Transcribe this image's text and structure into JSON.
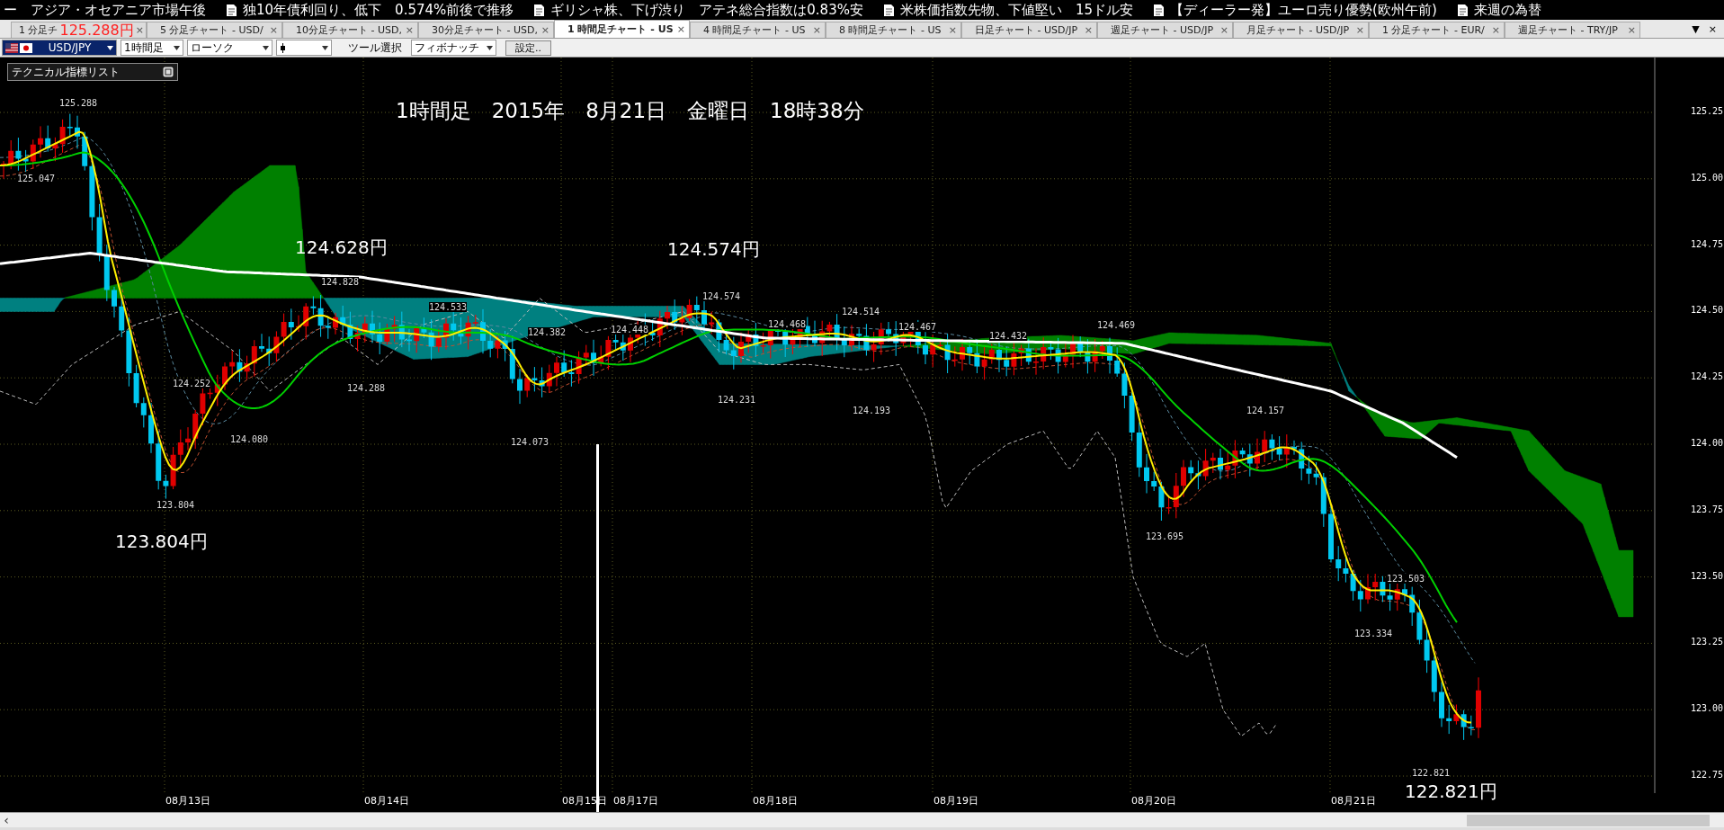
{
  "ticker": {
    "lead": "ー　アジア・オセアニア市場午後",
    "items": [
      "独10年債利回り、低下　0.574%前後で推移",
      "ギリシャ株、下げ渋り　アテネ総合指数は0.83%安",
      "米株価指数先物、下値堅い　15ドル安",
      "【ディーラー発】ユーロ売り優勢(欧州午前)",
      "来週の為替"
    ]
  },
  "tabs": [
    {
      "label": "1 分足チ",
      "selected": false
    },
    {
      "label": "5 分足チャート - USD/",
      "selected": false
    },
    {
      "label": "10分足チャート - USD,",
      "selected": false
    },
    {
      "label": "30分足チャート - USD,",
      "selected": false
    },
    {
      "label": "1 時間足チャート - US",
      "selected": true
    },
    {
      "label": "4 時間足チャート - US",
      "selected": false
    },
    {
      "label": "8 時間足チャート - US",
      "selected": false
    },
    {
      "label": "日足チャート - USD/JP",
      "selected": false
    },
    {
      "label": "週足チャート - USD/JP",
      "selected": false
    },
    {
      "label": "月足チャート - USD/JP",
      "selected": false
    },
    {
      "label": "1 分足チャート - EUR/",
      "selected": false
    },
    {
      "label": "週足チャート - TRY/JP",
      "selected": false
    }
  ],
  "tab_close": "×",
  "tab_menu": "▼",
  "overlay_price": "125.288円",
  "toolbar": {
    "symbol": "USD/JPY",
    "timeframe": "1時間足",
    "chart_type": "ローソク",
    "tool_label": "ツール選択",
    "tool": "フィボナッチ",
    "settings_button": "設定.."
  },
  "chart": {
    "indicator_panel": "テクニカル指標リスト",
    "title": "1時間足　2015年　8月21日　金曜日　18時38分",
    "y_ticks": [
      "125.25",
      "125.00",
      "124.75",
      "124.50",
      "124.25",
      "124.00",
      "123.75",
      "123.50",
      "123.25",
      "123.00",
      "122.75"
    ],
    "x_labels": [
      "08月13日",
      "08月14日",
      "08月15日",
      "08月17日",
      "08月18日",
      "08月19日",
      "08月20日",
      "08月21日"
    ],
    "price_labels": [
      "125.288",
      "125.047",
      "124.828",
      "124.533",
      "124.252",
      "124.288",
      "124.080",
      "124.382",
      "124.448",
      "124.574",
      "124.468",
      "124.231",
      "124.073",
      "124.514",
      "123.804",
      "124.193",
      "124.467",
      "124.432",
      "124.469",
      "124.157",
      "123.695",
      "123.503",
      "123.334",
      "122.821"
    ],
    "big_price_labels": [
      "124.628円",
      "124.574円",
      "123.804円",
      "122.821円"
    ]
  },
  "scrollbar": {
    "left_arrow": "‹"
  }
}
